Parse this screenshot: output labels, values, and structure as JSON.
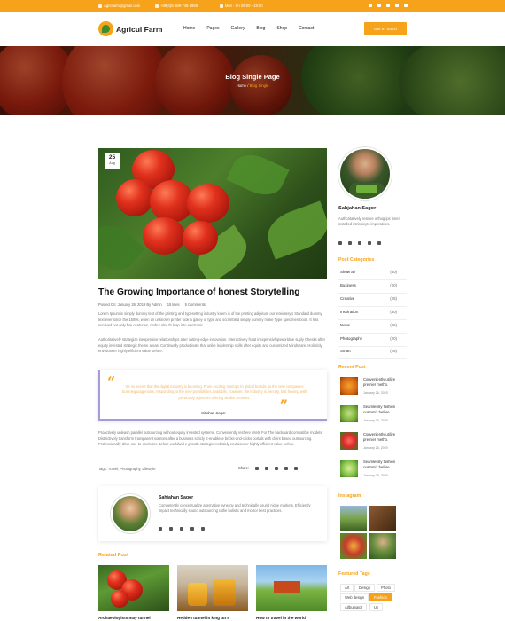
{
  "topbar": {
    "email": "Agricfarm@gmail.com",
    "phone": "+88(0)6-589-745-6985",
    "hours": "Mon - Fri 09:00 - 18:00",
    "social_icons": [
      "twitter-icon",
      "behance-icon",
      "pinterest-icon",
      "vimeo-icon",
      "linkedin-icon"
    ]
  },
  "header": {
    "logo_text": "Agricul Farm",
    "nav": [
      "Home",
      "Pages",
      "Gallery",
      "Blog",
      "Shop",
      "Contact"
    ],
    "cta": "Get In Touch"
  },
  "hero": {
    "title": "Blog Single Page",
    "crumb_home": "Home",
    "crumb_sep": " / ",
    "crumb_current": "Blog Single"
  },
  "post": {
    "date_day": "25",
    "date_month": "Aug",
    "title": "The Growing Importance of honest Storytelling",
    "meta": {
      "posted": "Posted On: January 26, 2019 By Admin",
      "likes": "15 likes",
      "comments": "5 Comments"
    },
    "para1": "Lorem Ipsum is simply dummy text of the printing and typesetting industry lorem is of the printing adipisum our lereintery's Standard dummy text ever since the 1500s, when an unknown printer took a galley of type and scrambled simply dummy make Type specimen book. It has survived not only five centuries, ritobut also th leap into electronic.",
    "para2": "Authoritatively strategize inexpensive relationships after cutting-edge innovation. Interactively fscat inexpensivhipsworldwe suply Chesks after equity invested strategic theme areas. Continually productivate that unike leadership skills after equity and customized Mindshare. Holisticly envisioneer highly efficient value before.",
    "quote": {
      "text": "It's no secret that the digital industry is booming. From exciting startups to global brands, to the new companies businiegsaagencies, responding to the new possibilities available, however, the industry is fiercely, fast fevsing with previously agencies offering similar services.",
      "author": "Sitjahan Sagor"
    },
    "para3": "Proactively unleash parallel outsourcing without equity invested systems. Conveniently reshere mtets For The backward compatible models. Distinctively transform transparent sources after a business scricly E-enablese bricks-and-clicks portals with client based outsourcing. Professionally drive one-to-oneitures Before worldwid e growth strategie Holisticly envisioneer highly efficient value before.",
    "tags_line": "Tags: Travel, Photography, Lifestyle",
    "share_label": "Share:",
    "share_icons": [
      "facebook-icon",
      "behance-icon",
      "pinterest-icon",
      "vimeo-icon",
      "linkedin-icon"
    ]
  },
  "author": {
    "name": "Sahjahan Sagor",
    "bio": "Competently conceptualize alternative synergy and technically sound niche markets. Efficiently impact technically sound outsourcing rathe holistic and mortor best practices.",
    "social_icons": [
      "twitter-icon",
      "behance-icon",
      "pinterest-icon",
      "vimeo-icon",
      "linkedin-icon"
    ]
  },
  "related": {
    "heading": "Related Post",
    "items": [
      {
        "label": "Archaeologists may tunnel"
      },
      {
        "label": "Hedden tunnel in king tut's"
      },
      {
        "label": "How to travel in the world"
      }
    ]
  },
  "sidebar": {
    "profile": {
      "name": "Sahjahan Sagor",
      "bio": "Authoritatively restore orthog ips inner installed intrinsicyts imperatives.",
      "social_icons": [
        "twitter-icon",
        "behance-icon",
        "pinterest-icon",
        "vimeo-icon",
        "linkedin-icon"
      ]
    },
    "categories_heading": "Post  Categories",
    "categories": [
      {
        "name": "Show all",
        "count": "(50)"
      },
      {
        "name": "Business",
        "count": "(20)"
      },
      {
        "name": "Creative",
        "count": "(25)"
      },
      {
        "name": "Inspiration",
        "count": "(30)"
      },
      {
        "name": "News",
        "count": "(26)"
      },
      {
        "name": "Photography",
        "count": "(20)"
      },
      {
        "name": "Smart",
        "count": "(25)"
      }
    ],
    "recent_heading": "Recent Post",
    "recent": [
      {
        "title": "Conveniently utilize premier metho.",
        "date": "January 26, 2020"
      },
      {
        "title": "Seamlessly fashion customiz before.",
        "date": "January 26, 2020"
      },
      {
        "title": "Conveniently utilize premier metho.",
        "date": "January 26, 2020"
      },
      {
        "title": "Seamlessly fashion customiz before.",
        "date": "January 26, 2020"
      }
    ],
    "instagram_heading": "Instagram",
    "tags_heading": "Featured Tags",
    "tags": [
      {
        "label": "Art",
        "active": false
      },
      {
        "label": "Design",
        "active": false
      },
      {
        "label": "Photo",
        "active": false
      },
      {
        "label": "Web design",
        "active": false
      },
      {
        "label": "Fashion",
        "active": true
      },
      {
        "label": "Atlbumator",
        "active": false
      },
      {
        "label": "Ux",
        "active": false
      }
    ]
  },
  "colors": {
    "accent": "#f7a21b",
    "quote_border": "#a39cd9",
    "dark_text": "#222222"
  }
}
